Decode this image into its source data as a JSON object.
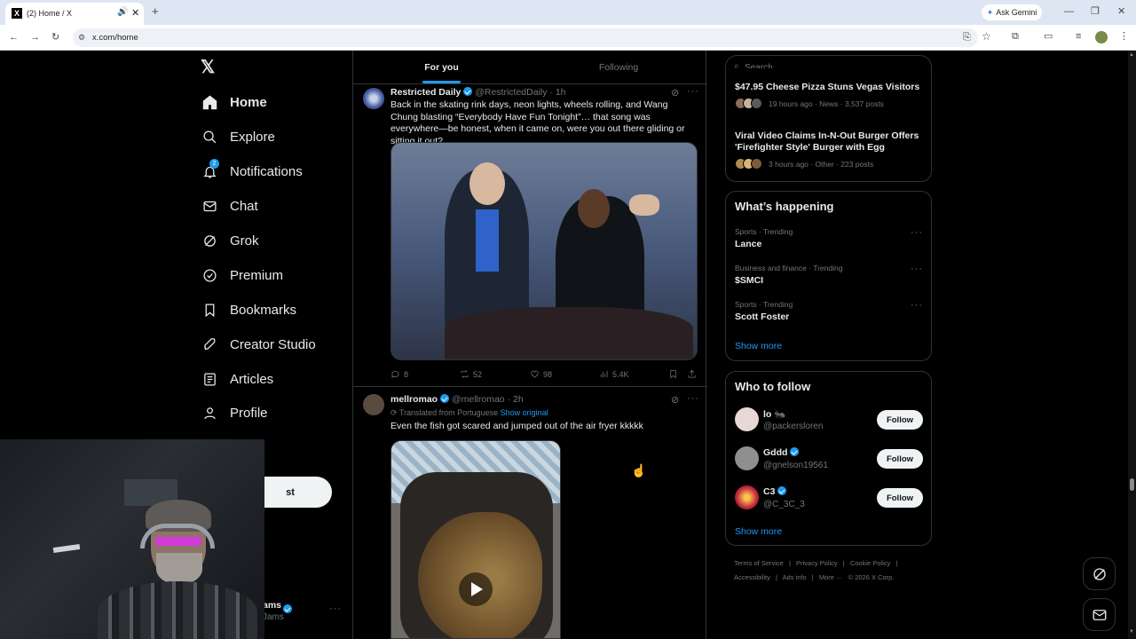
{
  "browser": {
    "tab_title": "(2) Home / X",
    "url": "x.com/home",
    "gemini_label": "Ask Gemini"
  },
  "nav": {
    "items": [
      {
        "label": "Home",
        "icon": "home-icon"
      },
      {
        "label": "Explore",
        "icon": "search-icon"
      },
      {
        "label": "Notifications",
        "icon": "bell-icon",
        "badge": "2"
      },
      {
        "label": "Chat",
        "icon": "mail-icon"
      },
      {
        "label": "Grok",
        "icon": "grok-icon"
      },
      {
        "label": "Premium",
        "icon": "verified-badge-icon"
      },
      {
        "label": "Bookmarks",
        "icon": "bookmark-icon"
      },
      {
        "label": "Creator Studio",
        "icon": "rocket-icon"
      },
      {
        "label": "Articles",
        "icon": "article-icon"
      },
      {
        "label": "Profile",
        "icon": "person-icon"
      }
    ],
    "post_button_partial": "st",
    "account_name_partial": "ams",
    "account_handle_partial": "Jams"
  },
  "feed": {
    "tabs": [
      "For you",
      "Following"
    ],
    "posts": [
      {
        "author": "Restricted Daily",
        "handle": "@RestrictedDaily",
        "time": "· 1h",
        "text": "Back in the skating rink days, neon lights, wheels rolling, and Wang Chung blasting “Everybody Have Fun Tonight”… that song was everywhere—be honest, when it came on, were you out there gliding or sitting it out?",
        "replies": "8",
        "reposts": "52",
        "likes": "98",
        "views": "5.4K"
      },
      {
        "author": "mellromao",
        "handle": "@mellromao",
        "time": "· 2h",
        "translated": "Translated from Portuguese",
        "show_original": "Show original",
        "text": "Even the fish got scared and jumped out of the air fryer kkkkk"
      }
    ]
  },
  "search": {
    "placeholder": "Search"
  },
  "trending_top": [
    {
      "title": "$47.95 Cheese Pizza Stuns Vegas Visitors",
      "meta": "19 hours ago · News · 3,537 posts"
    },
    {
      "title": "Viral Video Claims In-N-Out Burger Offers 'Firefighter Style' Burger with Egg",
      "meta": "3 hours ago · Other · 223 posts"
    }
  ],
  "happening": {
    "title": "What’s happening",
    "trends": [
      {
        "meta": "Sports · Trending",
        "title": "Lance"
      },
      {
        "meta": "Business and finance · Trending",
        "title": "$SMCI"
      },
      {
        "meta": "Sports · Trending",
        "title": "Scott Foster"
      }
    ],
    "show_more": "Show more"
  },
  "who_to_follow": {
    "title": "Who to follow",
    "accounts": [
      {
        "name": "lo 🐜",
        "handle": "@packersloren",
        "verified": false
      },
      {
        "name": "Gddd",
        "handle": "@gnelson19561",
        "verified": true
      },
      {
        "name": "C3",
        "handle": "@C_3C_3",
        "verified": true
      }
    ],
    "follow_label": "Follow",
    "show_more": "Show more"
  },
  "footer": {
    "links": [
      "Terms of Service",
      "Privacy Policy",
      "Cookie Policy",
      "Accessibility",
      "Ads info",
      "More ···",
      "© 2026 X Corp."
    ]
  },
  "colors": {
    "accent": "#1d9bf0",
    "background": "#000000",
    "border": "#2f3336",
    "muted": "#71767b"
  }
}
